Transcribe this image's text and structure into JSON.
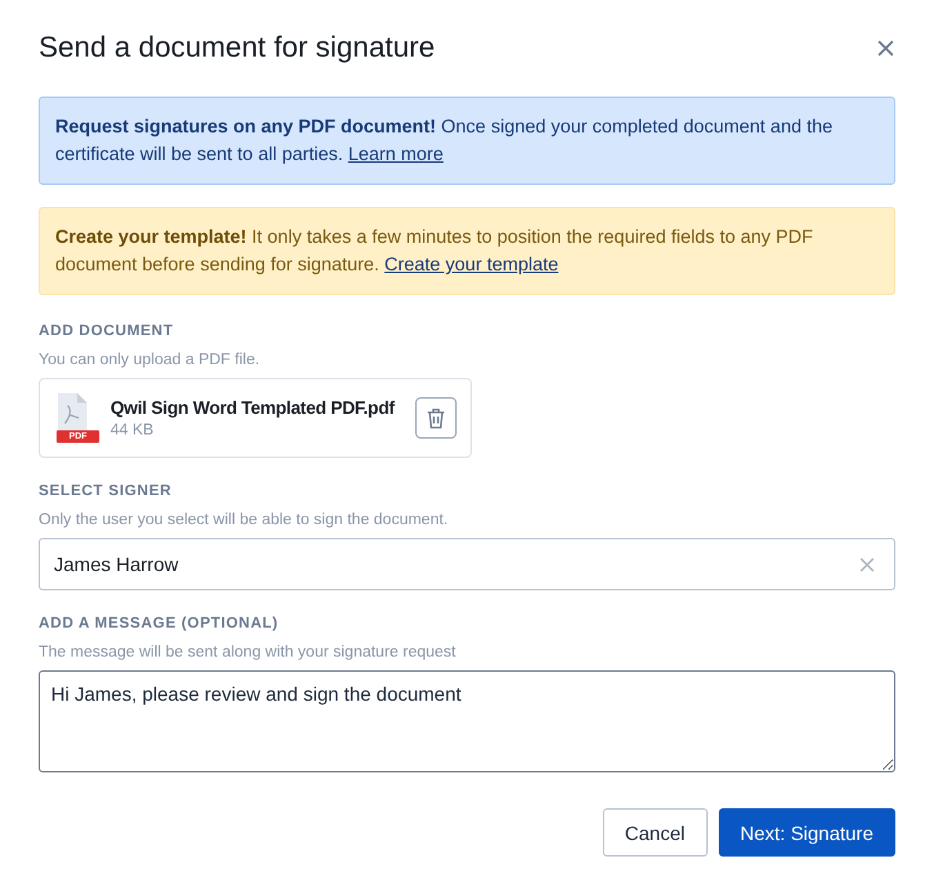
{
  "dialog": {
    "title": "Send a document for signature"
  },
  "alerts": [
    {
      "kind": "info",
      "bold": "Request signatures on any PDF document!",
      "text": " Once signed your completed document and the certificate will be sent to all parties. ",
      "link": "Learn more"
    },
    {
      "kind": "warning",
      "bold": "Create your template!",
      "text": " It only takes a few minutes to position the required fields to any PDF document before sending for signature. ",
      "link": "Create your template"
    }
  ],
  "document": {
    "label": "ADD DOCUMENT",
    "hint": "You can only upload a PDF file.",
    "file": {
      "name": "Qwil Sign Word Templated PDF.pdf",
      "size": "44 KB",
      "badge": "PDF"
    }
  },
  "signer": {
    "label": "SELECT SIGNER",
    "hint": "Only the user you select will be able to sign the document.",
    "value": "James Harrow"
  },
  "message": {
    "label": "ADD A MESSAGE (OPTIONAL)",
    "hint": "The message will be sent along with your signature request",
    "value": "Hi James, please review and sign the document"
  },
  "buttons": [
    {
      "kind": "secondary",
      "label": "Cancel"
    },
    {
      "kind": "primary",
      "label": "Next: Signature"
    }
  ]
}
